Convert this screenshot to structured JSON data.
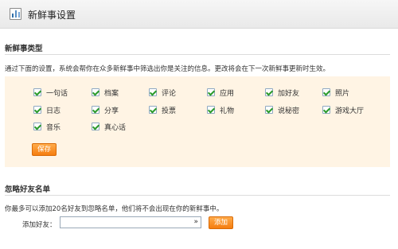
{
  "header": {
    "title": "新鲜事设置",
    "icon": "chart-icon"
  },
  "types_section": {
    "title": "新鲜事类型",
    "description": "通过下面的设置，系统会帮你在众多新鲜事中筛选出你是关注的信息。更改将会在下一次新鲜事更新时生效。",
    "options": [
      {
        "label": "一句话",
        "checked": true
      },
      {
        "label": "档案",
        "checked": true
      },
      {
        "label": "评论",
        "checked": true
      },
      {
        "label": "应用",
        "checked": true
      },
      {
        "label": "加好友",
        "checked": true
      },
      {
        "label": "照片",
        "checked": true
      },
      {
        "label": "日志",
        "checked": true
      },
      {
        "label": "分享",
        "checked": true
      },
      {
        "label": "投票",
        "checked": true
      },
      {
        "label": "礼物",
        "checked": true
      },
      {
        "label": "说秘密",
        "checked": true
      },
      {
        "label": "游戏大厅",
        "checked": true
      },
      {
        "label": "音乐",
        "checked": true
      },
      {
        "label": "真心话",
        "checked": true
      }
    ],
    "save_label": "保存"
  },
  "ignore_section": {
    "title": "忽略好友名单",
    "description": "你最多可以添加20名好友到忽略名单，他们将不会出现在你的新鲜事中。",
    "field_label": "添加好友：",
    "field_value": "",
    "add_label": "添加"
  },
  "colors": {
    "accent": "#f57d0f",
    "options_bg": "#fff4e4",
    "check": "#2a9a2a"
  }
}
